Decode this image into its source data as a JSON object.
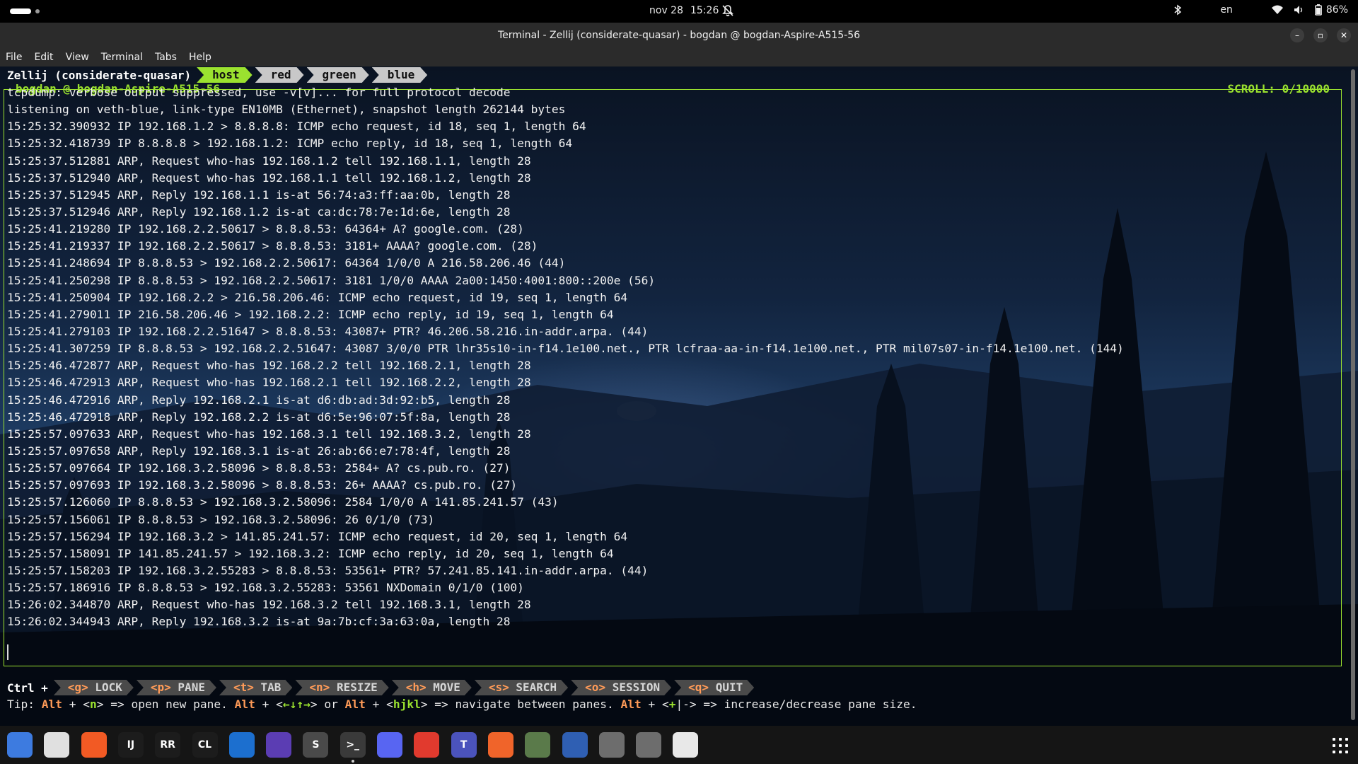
{
  "topbar": {
    "date": "nov 28",
    "time": "15:26",
    "language": "en",
    "battery": "86%"
  },
  "window": {
    "title": "Terminal - Zellij (considerate-quasar) - bogdan @ bogdan-Aspire-A515-56",
    "controls": [
      "–",
      "▫",
      "✕"
    ]
  },
  "menu": {
    "items": [
      "File",
      "Edit",
      "View",
      "Terminal",
      "Tabs",
      "Help"
    ]
  },
  "zellij": {
    "session": "Zellij (considerate-quasar)",
    "tabs": [
      {
        "label": "host",
        "active": true
      },
      {
        "label": "red",
        "active": false
      },
      {
        "label": "green",
        "active": false
      },
      {
        "label": "blue",
        "active": false
      }
    ],
    "pane_title": "bogdan @ bogdan-Aspire-A515-56",
    "scroll": "SCROLL:  0/10000",
    "lines": [
      "tcpdump: verbose output suppressed, use -v[v]... for full protocol decode",
      "listening on veth-blue, link-type EN10MB (Ethernet), snapshot length 262144 bytes",
      "15:25:32.390932 IP 192.168.1.2 > 8.8.8.8: ICMP echo request, id 18, seq 1, length 64",
      "15:25:32.418739 IP 8.8.8.8 > 192.168.1.2: ICMP echo reply, id 18, seq 1, length 64",
      "15:25:37.512881 ARP, Request who-has 192.168.1.2 tell 192.168.1.1, length 28",
      "15:25:37.512940 ARP, Request who-has 192.168.1.1 tell 192.168.1.2, length 28",
      "15:25:37.512945 ARP, Reply 192.168.1.1 is-at 56:74:a3:ff:aa:0b, length 28",
      "15:25:37.512946 ARP, Reply 192.168.1.2 is-at ca:dc:78:7e:1d:6e, length 28",
      "15:25:41.219280 IP 192.168.2.2.50617 > 8.8.8.53: 64364+ A? google.com. (28)",
      "15:25:41.219337 IP 192.168.2.2.50617 > 8.8.8.53: 3181+ AAAA? google.com. (28)",
      "15:25:41.248694 IP 8.8.8.53 > 192.168.2.2.50617: 64364 1/0/0 A 216.58.206.46 (44)",
      "15:25:41.250298 IP 8.8.8.53 > 192.168.2.2.50617: 3181 1/0/0 AAAA 2a00:1450:4001:800::200e (56)",
      "15:25:41.250904 IP 192.168.2.2 > 216.58.206.46: ICMP echo request, id 19, seq 1, length 64",
      "15:25:41.279011 IP 216.58.206.46 > 192.168.2.2: ICMP echo reply, id 19, seq 1, length 64",
      "15:25:41.279103 IP 192.168.2.2.51647 > 8.8.8.53: 43087+ PTR? 46.206.58.216.in-addr.arpa. (44)",
      "15:25:41.307259 IP 8.8.8.53 > 192.168.2.2.51647: 43087 3/0/0 PTR lhr35s10-in-f14.1e100.net., PTR lcfraa-aa-in-f14.1e100.net., PTR mil07s07-in-f14.1e100.net. (144)",
      "15:25:46.472877 ARP, Request who-has 192.168.2.2 tell 192.168.2.1, length 28",
      "15:25:46.472913 ARP, Request who-has 192.168.2.1 tell 192.168.2.2, length 28",
      "15:25:46.472916 ARP, Reply 192.168.2.1 is-at d6:db:ad:3d:92:b5, length 28",
      "15:25:46.472918 ARP, Reply 192.168.2.2 is-at d6:5e:96:07:5f:8a, length 28",
      "15:25:57.097633 ARP, Request who-has 192.168.3.1 tell 192.168.3.2, length 28",
      "15:25:57.097658 ARP, Reply 192.168.3.1 is-at 26:ab:66:e7:78:4f, length 28",
      "15:25:57.097664 IP 192.168.3.2.58096 > 8.8.8.53: 2584+ A? cs.pub.ro. (27)",
      "15:25:57.097693 IP 192.168.3.2.58096 > 8.8.8.53: 26+ AAAA? cs.pub.ro. (27)",
      "15:25:57.126060 IP 8.8.8.53 > 192.168.3.2.58096: 2584 1/0/0 A 141.85.241.57 (43)",
      "15:25:57.156061 IP 8.8.8.53 > 192.168.3.2.58096: 26 0/1/0 (73)",
      "15:25:57.156294 IP 192.168.3.2 > 141.85.241.57: ICMP echo request, id 20, seq 1, length 64",
      "15:25:57.158091 IP 141.85.241.57 > 192.168.3.2: ICMP echo reply, id 20, seq 1, length 64",
      "15:25:57.158203 IP 192.168.3.2.55283 > 8.8.8.53: 53561+ PTR? 57.241.85.141.in-addr.arpa. (44)",
      "15:25:57.186916 IP 8.8.8.53 > 192.168.3.2.55283: 53561 NXDomain 0/1/0 (100)",
      "15:26:02.344870 ARP, Request who-has 192.168.3.2 tell 192.168.3.1, length 28",
      "15:26:02.344943 ARP, Reply 192.168.3.2 is-at 9a:7b:cf:3a:63:0a, length 28"
    ],
    "keybar": {
      "prefix": "Ctrl +",
      "items": [
        {
          "key": "<g>",
          "label": "LOCK"
        },
        {
          "key": "<p>",
          "label": "PANE"
        },
        {
          "key": "<t>",
          "label": "TAB"
        },
        {
          "key": "<n>",
          "label": "RESIZE"
        },
        {
          "key": "<h>",
          "label": "MOVE"
        },
        {
          "key": "<s>",
          "label": "SEARCH"
        },
        {
          "key": "<o>",
          "label": "SESSION"
        },
        {
          "key": "<q>",
          "label": "QUIT"
        }
      ]
    },
    "tip": {
      "t1": "Tip: ",
      "alt1": "Alt",
      "t2": " + <",
      "n": "n",
      "t3": "> => open new pane. ",
      "alt2": "Alt",
      "t4": " + <",
      "arrows": "←↓↑→",
      "t5": "> or ",
      "alt3": "Alt",
      "t6": " + <",
      "hjkl": "hjkl",
      "t7": "> => navigate between panes. ",
      "alt4": "Alt",
      "t8": " + <",
      "plus": "+",
      "t9": "|-> => increase/decrease pane size."
    }
  },
  "dock": {
    "apps": [
      {
        "name": "files-icon",
        "label": "",
        "color": "#3d7be0"
      },
      {
        "name": "chrome-icon",
        "label": "",
        "color": "#e0e0e0"
      },
      {
        "name": "brave-icon",
        "label": "",
        "color": "#f25a24"
      },
      {
        "name": "intellij-icon",
        "label": "IJ",
        "color": "#1c1c1c"
      },
      {
        "name": "rustrover-icon",
        "label": "RR",
        "color": "#1c1c1c"
      },
      {
        "name": "clion-icon",
        "label": "CL",
        "color": "#1c1c1c"
      },
      {
        "name": "vscode-icon",
        "label": "",
        "color": "#1c6fcf"
      },
      {
        "name": "obsidian-icon",
        "label": "",
        "color": "#5b3db3"
      },
      {
        "name": "sublime-icon",
        "label": "S",
        "color": "#4a4a4a"
      },
      {
        "name": "terminal-icon",
        "label": ">_",
        "color": "#3a3a3a"
      },
      {
        "name": "discord-icon",
        "label": "",
        "color": "#5865f2"
      },
      {
        "name": "pdf-reader-icon",
        "label": "",
        "color": "#e13a2e"
      },
      {
        "name": "teams-icon",
        "label": "T",
        "color": "#4b53bc"
      },
      {
        "name": "pen-tool-icon",
        "label": "",
        "color": "#f0642a"
      },
      {
        "name": "network-tool-icon",
        "label": "",
        "color": "#5a7a4a"
      },
      {
        "name": "list-app-icon",
        "label": "",
        "color": "#2f5fb3"
      },
      {
        "name": "disk-icon",
        "label": "",
        "color": "#6d6d6d"
      },
      {
        "name": "disk-icon-2",
        "label": "",
        "color": "#6d6d6d"
      },
      {
        "name": "trash-icon",
        "label": "",
        "color": "#e8e8e8"
      }
    ]
  },
  "colors": {
    "accent_green": "#9be22f",
    "key_orange": "#ff9b58"
  }
}
